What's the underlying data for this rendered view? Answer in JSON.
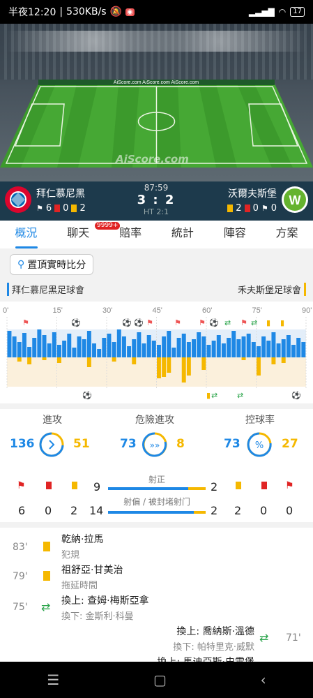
{
  "status": {
    "time": "半夜12:20",
    "speed": "530KB/s",
    "battery": "17"
  },
  "pitch": {
    "watermark": "AiScore.com",
    "ad": "AiScore.com"
  },
  "match": {
    "home": {
      "name": "拜仁慕尼黑",
      "corners": "6",
      "red": "0",
      "yellow": "2"
    },
    "away": {
      "name": "沃爾夫斯堡",
      "yellow": "2",
      "red": "0",
      "corners": "0"
    },
    "minute": "87:59",
    "score": "3 : 2",
    "ht": "HT 2:1"
  },
  "tabs": [
    {
      "label": "概況"
    },
    {
      "label": "聊天"
    },
    {
      "label": "賠率"
    },
    {
      "label": "統計"
    },
    {
      "label": "陣容"
    },
    {
      "label": "方案"
    }
  ],
  "chat_badge": "9999+",
  "pin_label": "置頂實時比分",
  "clubs": {
    "home": "拜仁慕尼黑足球會",
    "away": "禾夫斯堡足球會"
  },
  "timeline": {
    "ticks": [
      "0'",
      "15'",
      "30'",
      "45'",
      "60'",
      "75'",
      "90'"
    ],
    "home_bars": [
      38,
      30,
      22,
      35,
      15,
      28,
      40,
      32,
      20,
      36,
      18,
      24,
      34,
      14,
      30,
      26,
      38,
      20,
      12,
      28,
      34,
      22,
      40,
      30,
      16,
      26,
      36,
      20,
      32,
      24,
      18,
      30,
      38,
      14,
      28,
      34,
      22,
      26,
      36,
      30,
      18,
      24,
      32,
      20,
      28,
      38,
      26,
      30,
      34,
      22,
      16,
      30,
      24,
      36,
      20,
      26,
      32,
      18,
      28,
      22
    ],
    "away_bars": [
      0,
      0,
      6,
      0,
      10,
      0,
      0,
      4,
      0,
      0,
      8,
      0,
      0,
      0,
      0,
      0,
      14,
      0,
      0,
      0,
      0,
      6,
      0,
      0,
      0,
      10,
      0,
      0,
      0,
      0,
      30,
      28,
      22,
      0,
      0,
      36,
      26,
      0,
      0,
      18,
      0,
      0,
      0,
      0,
      0,
      0,
      0,
      4,
      0,
      0,
      26,
      0,
      0,
      10,
      0,
      8,
      0,
      0,
      0,
      0
    ]
  },
  "stats": {
    "attack": {
      "label": "進攻",
      "home": "136",
      "away": "51"
    },
    "dangerous": {
      "label": "危險進攻",
      "home": "73",
      "away": "8"
    },
    "possession": {
      "label": "控球率",
      "home": "73",
      "away": "27"
    },
    "home_counts": {
      "corners": "6",
      "red": "0",
      "yellow": "2"
    },
    "away_counts": {
      "corners": "0",
      "red": "0",
      "yellow": "2"
    },
    "on_target": {
      "label": "射正",
      "home": "9",
      "away": "2",
      "home_ratio": 0.82
    },
    "off_target": {
      "label": "射偏 / 被封堵射门",
      "home": "14",
      "away": "2",
      "home_ratio": 0.88
    }
  },
  "events": [
    {
      "minute": "83'",
      "name": "乾納·拉馬",
      "sub": "犯規",
      "type": "yellow-card"
    },
    {
      "minute": "79'",
      "name": "祖舒亞·甘美治",
      "sub": "拖延時間",
      "type": "yellow-card"
    },
    {
      "minute": "75'",
      "name": "換上: 查姆·梅斯亞拿",
      "sub": "換下: 金斯利·科曼",
      "type": "substitution"
    },
    {
      "minute": "71'",
      "name": "換上: 喬納斯·溫德",
      "sub": "換下: 帕特里克·威默",
      "type": "substitution"
    },
    {
      "minute": "",
      "name": "換上: 馬迪亞斯·史雲堡",
      "sub": "",
      "type": "substitution"
    }
  ],
  "colors": {
    "home": "#1e88e5",
    "away": "#f5b800",
    "score_bar": "#1d3a4c"
  }
}
